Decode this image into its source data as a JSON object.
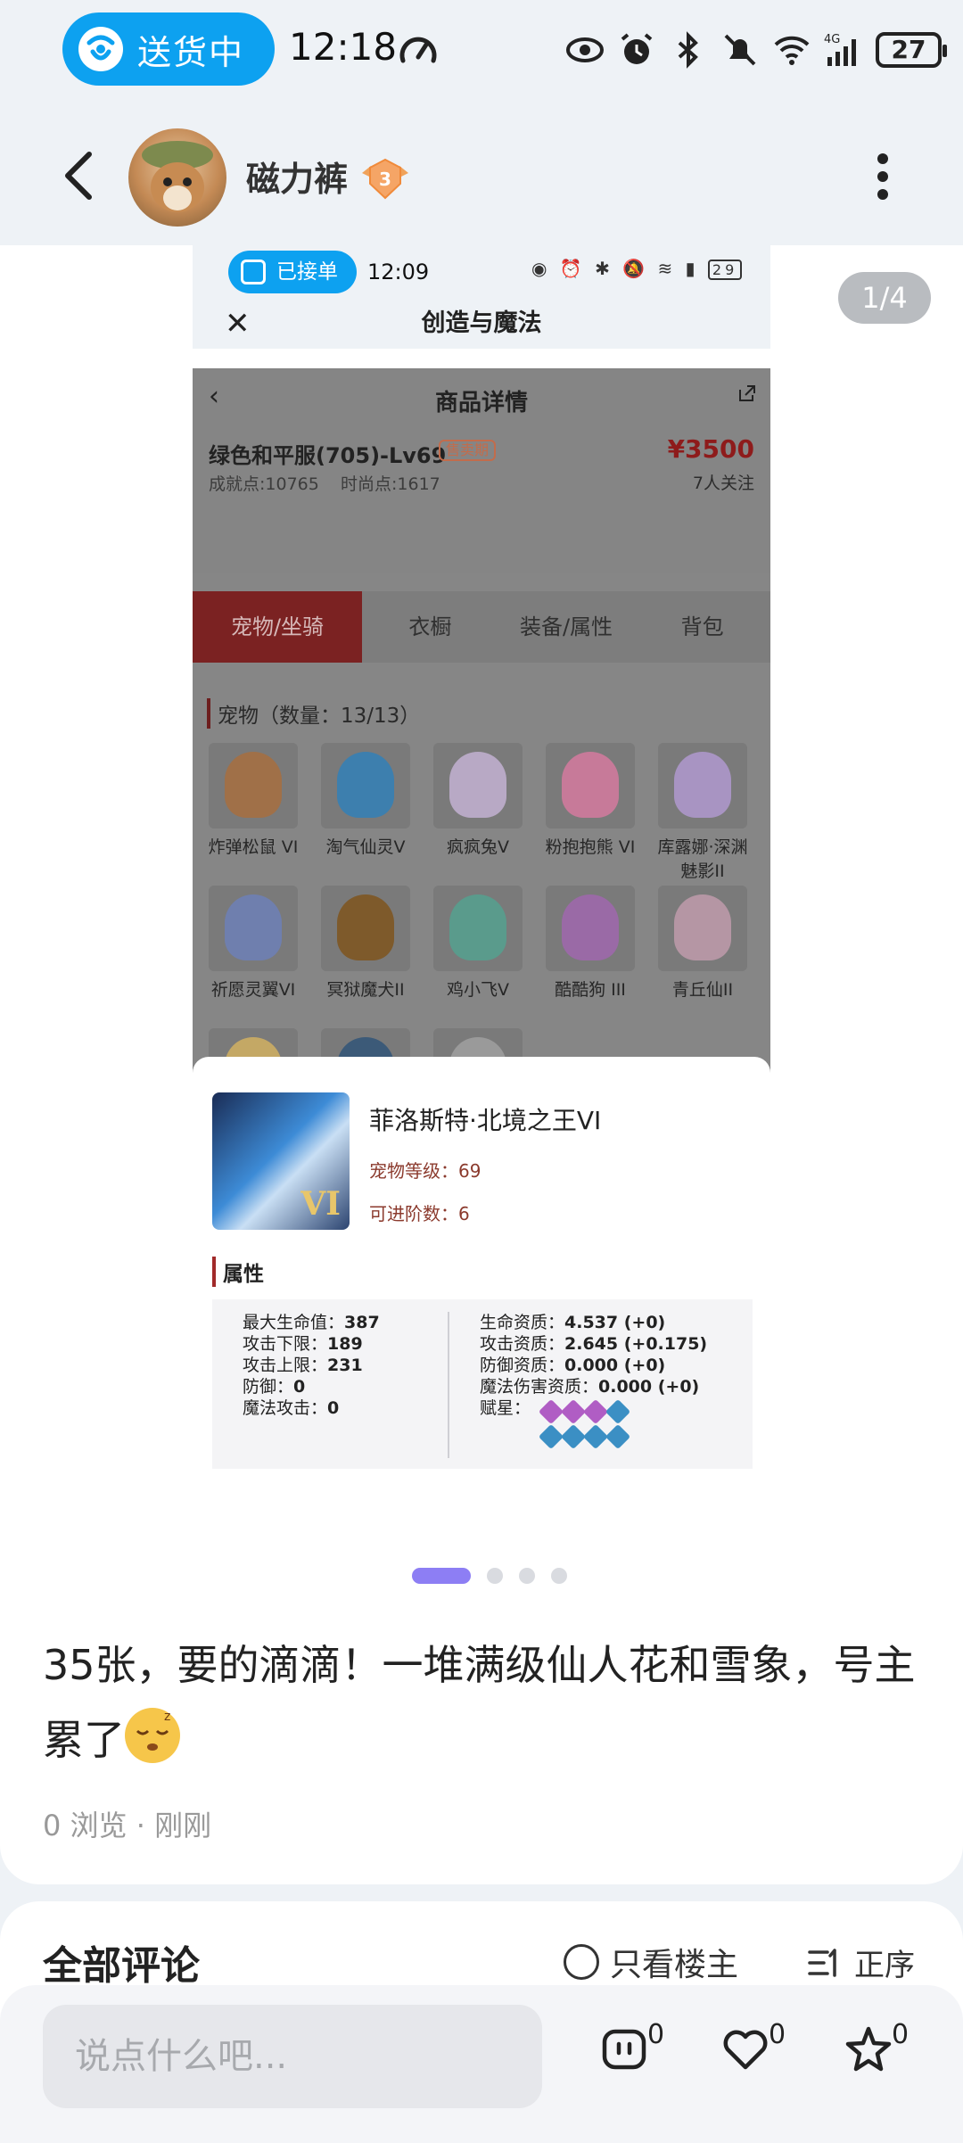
{
  "status_bar": {
    "delivery_label": "送货中",
    "time": "12:18",
    "battery": "27"
  },
  "header": {
    "username": "磁力裤",
    "level": "3"
  },
  "gallery": {
    "counter": "1/4"
  },
  "inner": {
    "status": {
      "order_label": "已接单",
      "time": "12:09",
      "battery": "29"
    },
    "app_title": "创造与魔法",
    "page_title": "商品详情",
    "product": {
      "name": "绿色和平服(705)-Lv69",
      "badge": "售卖期",
      "achievement": "成就点:10765",
      "fashion": "时尚点:1617",
      "price": "¥3500",
      "followers": "7人关注"
    },
    "tabs": [
      "宠物/坐骑",
      "衣橱",
      "装备/属性",
      "背包"
    ],
    "pets_section": "宠物（数量：13/13）",
    "pets": [
      {
        "name": "炸弹松鼠 VI",
        "color": "#a07048"
      },
      {
        "name": "淘气仙灵V",
        "color": "#3d7fae"
      },
      {
        "name": "疯疯兔V",
        "color": "#b8a9c5"
      },
      {
        "name": "粉抱抱熊 VI",
        "color": "#c77a99"
      },
      {
        "name": "库露娜·深渊魅影II",
        "color": "#a894c2"
      },
      {
        "name": "祈愿灵翼VI",
        "color": "#6f7fae"
      },
      {
        "name": "冥狱魔犬II",
        "color": "#7e5a2b"
      },
      {
        "name": "鸡小飞V",
        "color": "#5a9b8c"
      },
      {
        "name": "酷酷狗 III",
        "color": "#9a6aa6"
      },
      {
        "name": "青丘仙II",
        "color": "#b596a4"
      },
      {
        "name": "",
        "color": "#c4a865"
      },
      {
        "name": "",
        "color": "#3c5a78"
      },
      {
        "name": "",
        "color": "#9a9a9a"
      }
    ],
    "pet_detail": {
      "name": "菲洛斯特·北境之王VI",
      "level": "宠物等级：69",
      "advance": "可进阶数：6",
      "attr_title": "属性",
      "left_attrs": [
        {
          "k": "最大生命值：",
          "v": "387"
        },
        {
          "k": "攻击下限：",
          "v": "189"
        },
        {
          "k": "攻击上限：",
          "v": "231"
        },
        {
          "k": "防御：",
          "v": "0"
        },
        {
          "k": "魔法攻击：",
          "v": "0"
        }
      ],
      "right_attrs": [
        {
          "k": "生命资质：",
          "v": "4.537 (+0)"
        },
        {
          "k": "攻击资质：",
          "v": "2.645 (+0.175)"
        },
        {
          "k": "防御资质：",
          "v": "0.000 (+0)"
        },
        {
          "k": "魔法伤害资质：",
          "v": "0.000 (+0)"
        },
        {
          "k": "赋星：",
          "v": ""
        }
      ],
      "star_gem_colors": [
        "#b05dc4",
        "#b05dc4",
        "#b05dc4",
        "#3b8fc4",
        "#3b8fc4",
        "#3b8fc4",
        "#3b8fc4",
        "#3b8fc4"
      ]
    }
  },
  "post": {
    "text": "35张，要的滴滴！一堆满级仙人花和雪象，号主累了",
    "views": "0 浏览",
    "separator": "·",
    "time": "刚刚"
  },
  "comments": {
    "title": "全部评论",
    "only_op": "只看楼主",
    "sort": "正序"
  },
  "bottom_bar": {
    "placeholder": "说点什么吧...",
    "comment_count": "0",
    "like_count": "0",
    "fav_count": "0"
  },
  "colors": {
    "accent_blue": "#0da1f0",
    "indicator_purple": "#8d7ef4",
    "price_red": "#8e1b1b"
  }
}
